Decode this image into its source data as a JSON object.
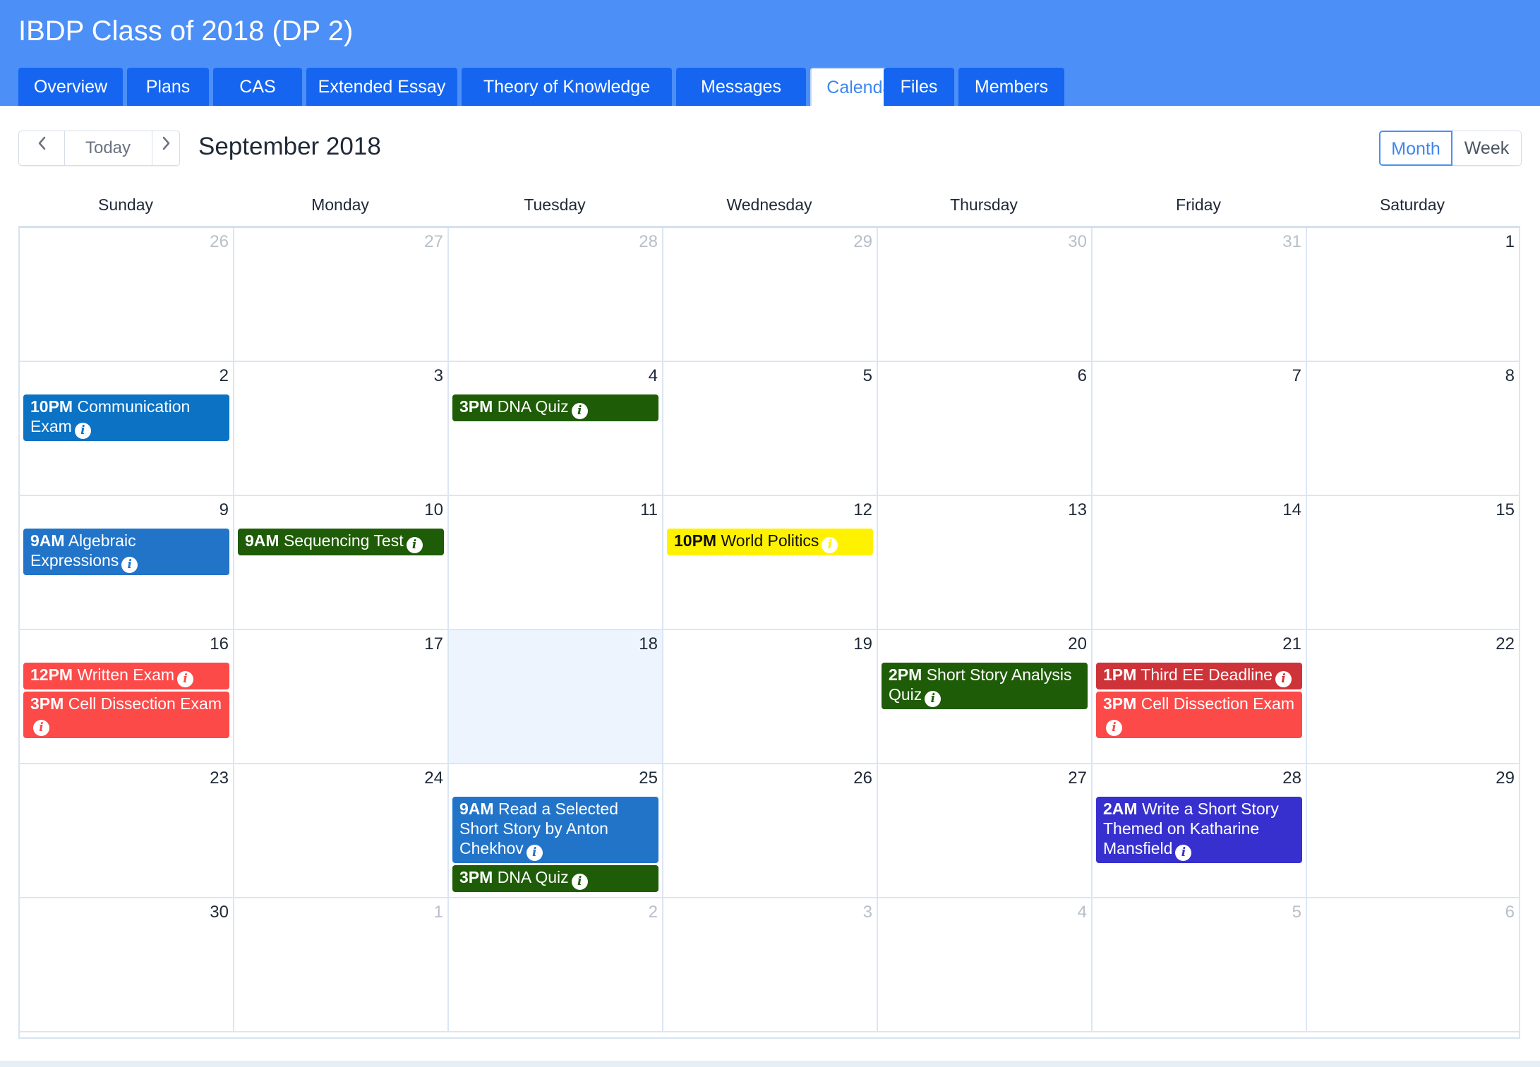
{
  "header": {
    "title": "IBDP Class of 2018 (DP 2)",
    "background": "#4b8ff7",
    "tabs": [
      {
        "label": "Overview",
        "active": false
      },
      {
        "label": "Plans",
        "active": false
      },
      {
        "label": "CAS",
        "active": false
      },
      {
        "label": "Extended Essay",
        "active": false
      },
      {
        "label": "Theory of Knowledge",
        "active": false
      },
      {
        "label": "Messages",
        "active": false
      },
      {
        "label": "Calendar",
        "active": true
      },
      {
        "label": "Files",
        "active": false
      },
      {
        "label": "Members",
        "active": false
      }
    ]
  },
  "toolbar": {
    "prev_icon": "chevron-left-icon",
    "today_label": "Today",
    "next_icon": "chevron-right-icon",
    "month_title": "September 2018",
    "view_month_label": "Month",
    "view_week_label": "Week",
    "active_view": "Month"
  },
  "calendar": {
    "weekdays": [
      "Sunday",
      "Monday",
      "Tuesday",
      "Wednesday",
      "Thursday",
      "Friday",
      "Saturday"
    ],
    "today": "18",
    "weeks": [
      [
        {
          "day": "26",
          "other": true,
          "events": []
        },
        {
          "day": "27",
          "other": true,
          "events": []
        },
        {
          "day": "28",
          "other": true,
          "events": []
        },
        {
          "day": "29",
          "other": true,
          "events": []
        },
        {
          "day": "30",
          "other": true,
          "events": []
        },
        {
          "day": "31",
          "other": true,
          "events": []
        },
        {
          "day": "1",
          "other": false,
          "events": []
        }
      ],
      [
        {
          "day": "2",
          "other": false,
          "events": [
            {
              "time": "10PM",
              "title": "Communication Exam",
              "color": "#0b72c4",
              "text_color": "#ffffff"
            }
          ]
        },
        {
          "day": "3",
          "other": false,
          "events": []
        },
        {
          "day": "4",
          "other": false,
          "events": [
            {
              "time": "3PM",
              "title": "DNA Quiz",
              "color": "#1f5c07",
              "text_color": "#ffffff"
            }
          ]
        },
        {
          "day": "5",
          "other": false,
          "events": []
        },
        {
          "day": "6",
          "other": false,
          "events": []
        },
        {
          "day": "7",
          "other": false,
          "events": []
        },
        {
          "day": "8",
          "other": false,
          "events": []
        }
      ],
      [
        {
          "day": "9",
          "other": false,
          "events": [
            {
              "time": "9AM",
              "title": "Algebraic Expressions",
              "color": "#2274c9",
              "text_color": "#ffffff"
            }
          ]
        },
        {
          "day": "10",
          "other": false,
          "events": [
            {
              "time": "9AM",
              "title": "Sequencing Test",
              "color": "#1f5c07",
              "text_color": "#ffffff"
            }
          ]
        },
        {
          "day": "11",
          "other": false,
          "events": []
        },
        {
          "day": "12",
          "other": false,
          "events": [
            {
              "time": "10PM",
              "title": "World Politics",
              "color": "#fff200",
              "text_color": "#111111"
            }
          ]
        },
        {
          "day": "13",
          "other": false,
          "events": []
        },
        {
          "day": "14",
          "other": false,
          "events": []
        },
        {
          "day": "15",
          "other": false,
          "events": []
        }
      ],
      [
        {
          "day": "16",
          "other": false,
          "events": [
            {
              "time": "12PM",
              "title": "Written Exam",
              "color": "#fc4a49",
              "text_color": "#ffffff"
            },
            {
              "time": "3PM",
              "title": "Cell Dissection Exam",
              "color": "#fc4a49",
              "text_color": "#ffffff"
            }
          ]
        },
        {
          "day": "17",
          "other": false,
          "events": []
        },
        {
          "day": "18",
          "other": false,
          "events": []
        },
        {
          "day": "19",
          "other": false,
          "events": []
        },
        {
          "day": "20",
          "other": false,
          "events": [
            {
              "time": "2PM",
              "title": "Short Story Analysis Quiz",
              "color": "#1f5c07",
              "text_color": "#ffffff"
            }
          ]
        },
        {
          "day": "21",
          "other": false,
          "events": [
            {
              "time": "1PM",
              "title": "Third EE Deadline",
              "color": "#cd3338",
              "text_color": "#ffffff"
            },
            {
              "time": "3PM",
              "title": "Cell Dissection Exam",
              "color": "#fc4a49",
              "text_color": "#ffffff"
            }
          ]
        },
        {
          "day": "22",
          "other": false,
          "events": []
        }
      ],
      [
        {
          "day": "23",
          "other": false,
          "events": []
        },
        {
          "day": "24",
          "other": false,
          "events": []
        },
        {
          "day": "25",
          "other": false,
          "events": [
            {
              "time": "9AM",
              "title": "Read a Selected Short Story by Anton Chekhov",
              "color": "#2274c9",
              "text_color": "#ffffff"
            },
            {
              "time": "3PM",
              "title": "DNA Quiz",
              "color": "#1f5c07",
              "text_color": "#ffffff"
            }
          ]
        },
        {
          "day": "26",
          "other": false,
          "events": []
        },
        {
          "day": "27",
          "other": false,
          "events": []
        },
        {
          "day": "28",
          "other": false,
          "events": [
            {
              "time": "2AM",
              "title": "Write a Short Story Themed on Katharine Mansfield",
              "color": "#3730cf",
              "text_color": "#ffffff"
            }
          ]
        },
        {
          "day": "29",
          "other": false,
          "events": []
        }
      ],
      [
        {
          "day": "30",
          "other": false,
          "events": []
        },
        {
          "day": "1",
          "other": true,
          "events": []
        },
        {
          "day": "2",
          "other": true,
          "events": []
        },
        {
          "day": "3",
          "other": true,
          "events": []
        },
        {
          "day": "4",
          "other": true,
          "events": []
        },
        {
          "day": "5",
          "other": true,
          "events": []
        },
        {
          "day": "6",
          "other": true,
          "events": []
        }
      ]
    ]
  }
}
